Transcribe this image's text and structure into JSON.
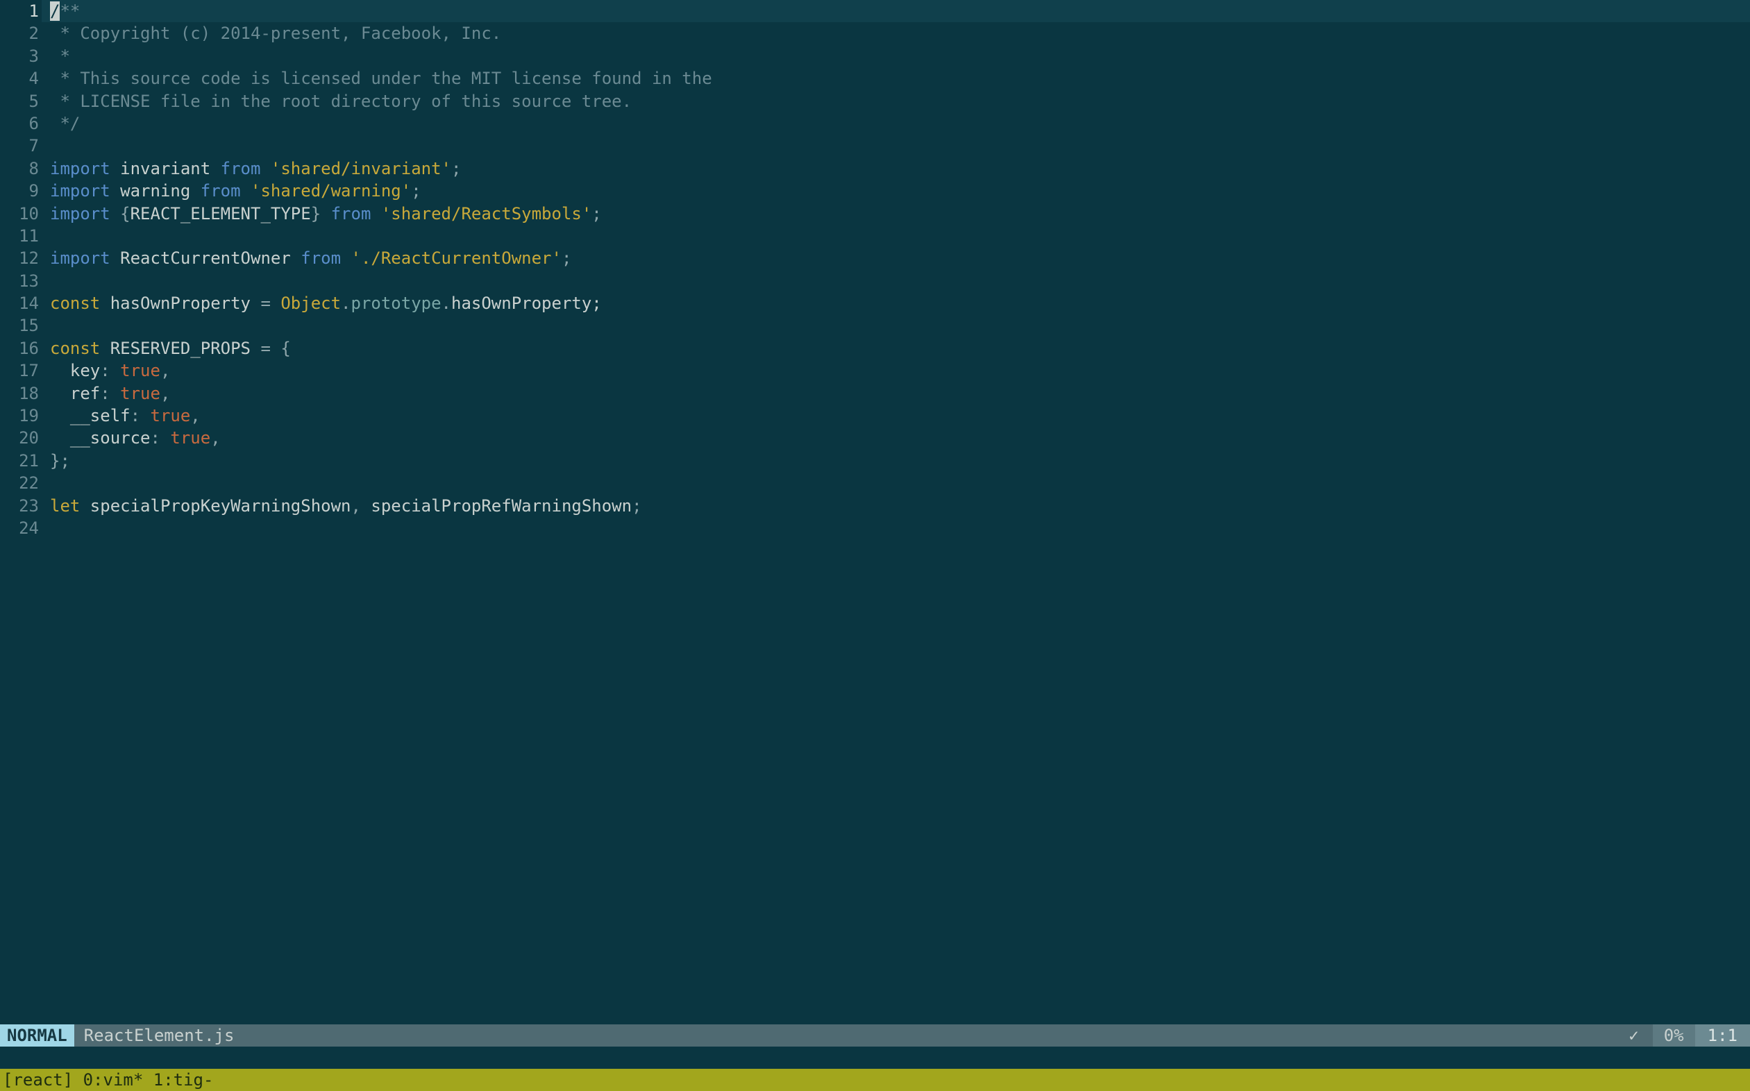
{
  "editor": {
    "total_lines": 24,
    "current_line": 1,
    "lines": [
      {
        "n": 1,
        "tokens": [
          {
            "t": "/",
            "cls": "cursor"
          },
          {
            "t": "**",
            "cls": "c-comment"
          }
        ]
      },
      {
        "n": 2,
        "tokens": [
          {
            "t": " * Copyright (c) 2014-present, Facebook, Inc.",
            "cls": "c-comment"
          }
        ]
      },
      {
        "n": 3,
        "tokens": [
          {
            "t": " *",
            "cls": "c-comment"
          }
        ]
      },
      {
        "n": 4,
        "tokens": [
          {
            "t": " * This source code is licensed under the MIT license found in the",
            "cls": "c-comment"
          }
        ]
      },
      {
        "n": 5,
        "tokens": [
          {
            "t": " * LICENSE file in the root directory of this source tree.",
            "cls": "c-comment"
          }
        ]
      },
      {
        "n": 6,
        "tokens": [
          {
            "t": " */",
            "cls": "c-comment"
          }
        ]
      },
      {
        "n": 7,
        "tokens": []
      },
      {
        "n": 8,
        "tokens": [
          {
            "t": "import",
            "cls": "c-keyword"
          },
          {
            "t": " invariant ",
            "cls": "c-default"
          },
          {
            "t": "from",
            "cls": "c-keyword"
          },
          {
            "t": " ",
            "cls": "c-default"
          },
          {
            "t": "'shared/invariant'",
            "cls": "c-string"
          },
          {
            "t": ";",
            "cls": "c-punct"
          }
        ]
      },
      {
        "n": 9,
        "tokens": [
          {
            "t": "import",
            "cls": "c-keyword"
          },
          {
            "t": " warning ",
            "cls": "c-default"
          },
          {
            "t": "from",
            "cls": "c-keyword"
          },
          {
            "t": " ",
            "cls": "c-default"
          },
          {
            "t": "'shared/warning'",
            "cls": "c-string"
          },
          {
            "t": ";",
            "cls": "c-punct"
          }
        ]
      },
      {
        "n": 10,
        "tokens": [
          {
            "t": "import",
            "cls": "c-keyword"
          },
          {
            "t": " ",
            "cls": "c-default"
          },
          {
            "t": "{",
            "cls": "c-punct"
          },
          {
            "t": "REACT_ELEMENT_TYPE",
            "cls": "c-default"
          },
          {
            "t": "}",
            "cls": "c-punct"
          },
          {
            "t": " ",
            "cls": "c-default"
          },
          {
            "t": "from",
            "cls": "c-keyword"
          },
          {
            "t": " ",
            "cls": "c-default"
          },
          {
            "t": "'shared/ReactSymbols'",
            "cls": "c-string"
          },
          {
            "t": ";",
            "cls": "c-punct"
          }
        ]
      },
      {
        "n": 11,
        "tokens": []
      },
      {
        "n": 12,
        "tokens": [
          {
            "t": "import",
            "cls": "c-keyword"
          },
          {
            "t": " ReactCurrentOwner ",
            "cls": "c-default"
          },
          {
            "t": "from",
            "cls": "c-keyword"
          },
          {
            "t": " ",
            "cls": "c-default"
          },
          {
            "t": "'./ReactCurrentOwner'",
            "cls": "c-string"
          },
          {
            "t": ";",
            "cls": "c-punct"
          }
        ]
      },
      {
        "n": 13,
        "tokens": []
      },
      {
        "n": 14,
        "tokens": [
          {
            "t": "const",
            "cls": "c-const"
          },
          {
            "t": " hasOwnProperty ",
            "cls": "c-default"
          },
          {
            "t": "=",
            "cls": "c-punct"
          },
          {
            "t": " ",
            "cls": "c-default"
          },
          {
            "t": "Object",
            "cls": "c-type"
          },
          {
            "t": ".",
            "cls": "c-punct"
          },
          {
            "t": "prototype",
            "cls": "c-proto"
          },
          {
            "t": ".",
            "cls": "c-punct"
          },
          {
            "t": "hasOwnProperty;",
            "cls": "c-default"
          }
        ]
      },
      {
        "n": 15,
        "tokens": []
      },
      {
        "n": 16,
        "tokens": [
          {
            "t": "const",
            "cls": "c-const"
          },
          {
            "t": " RESERVED_PROPS ",
            "cls": "c-default"
          },
          {
            "t": "=",
            "cls": "c-punct"
          },
          {
            "t": " ",
            "cls": "c-default"
          },
          {
            "t": "{",
            "cls": "c-punct"
          }
        ]
      },
      {
        "n": 17,
        "tokens": [
          {
            "t": "  key",
            "cls": "c-default"
          },
          {
            "t": ":",
            "cls": "c-punct"
          },
          {
            "t": " ",
            "cls": "c-default"
          },
          {
            "t": "true",
            "cls": "c-bool"
          },
          {
            "t": ",",
            "cls": "c-punct"
          }
        ]
      },
      {
        "n": 18,
        "tokens": [
          {
            "t": "  ref",
            "cls": "c-default"
          },
          {
            "t": ":",
            "cls": "c-punct"
          },
          {
            "t": " ",
            "cls": "c-default"
          },
          {
            "t": "true",
            "cls": "c-bool"
          },
          {
            "t": ",",
            "cls": "c-punct"
          }
        ]
      },
      {
        "n": 19,
        "tokens": [
          {
            "t": "  __self",
            "cls": "c-default"
          },
          {
            "t": ":",
            "cls": "c-punct"
          },
          {
            "t": " ",
            "cls": "c-default"
          },
          {
            "t": "true",
            "cls": "c-bool"
          },
          {
            "t": ",",
            "cls": "c-punct"
          }
        ]
      },
      {
        "n": 20,
        "tokens": [
          {
            "t": "  __source",
            "cls": "c-default"
          },
          {
            "t": ":",
            "cls": "c-punct"
          },
          {
            "t": " ",
            "cls": "c-default"
          },
          {
            "t": "true",
            "cls": "c-bool"
          },
          {
            "t": ",",
            "cls": "c-punct"
          }
        ]
      },
      {
        "n": 21,
        "tokens": [
          {
            "t": "}",
            "cls": "c-punct"
          },
          {
            "t": ";",
            "cls": "c-punct"
          }
        ]
      },
      {
        "n": 22,
        "tokens": []
      },
      {
        "n": 23,
        "tokens": [
          {
            "t": "let",
            "cls": "c-const"
          },
          {
            "t": " specialPropKeyWarningShown",
            "cls": "c-default"
          },
          {
            "t": ",",
            "cls": "c-punct"
          },
          {
            "t": " specialPropRefWarningShown",
            "cls": "c-default"
          },
          {
            "t": ";",
            "cls": "c-punct"
          }
        ]
      },
      {
        "n": 24,
        "tokens": []
      }
    ]
  },
  "statusline": {
    "mode": "NORMAL",
    "filename": "ReactElement.js",
    "lint_ok": "✓",
    "percent": "0%",
    "position": "1:1"
  },
  "tmux": {
    "session": "[react]",
    "windows": "0:vim* 1:tig-"
  }
}
